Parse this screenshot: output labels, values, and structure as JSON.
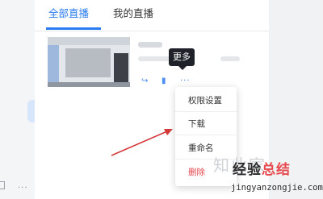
{
  "tabs": [
    {
      "label": "全部直播",
      "active": true
    },
    {
      "label": "我的直播",
      "active": false
    }
  ],
  "tooltip": {
    "text": "更多"
  },
  "actions": {
    "share_icon": "↪",
    "stats_icon": "▮",
    "more_icon": "···"
  },
  "menu": {
    "items": [
      {
        "label": "权限设置"
      },
      {
        "label": "下载"
      },
      {
        "label": "重命名"
      },
      {
        "label": "删除"
      }
    ]
  },
  "left_strip": {
    "dots": "···"
  },
  "watermark": {
    "brand": "知此家",
    "part1": "经验",
    "part2": "总结",
    "url": "jingyanzongjie.com"
  },
  "colors": {
    "accent": "#2a7bf2",
    "danger": "#e5484d",
    "tooltip_bg": "#1f2329",
    "arrow": "#d33b3b"
  }
}
